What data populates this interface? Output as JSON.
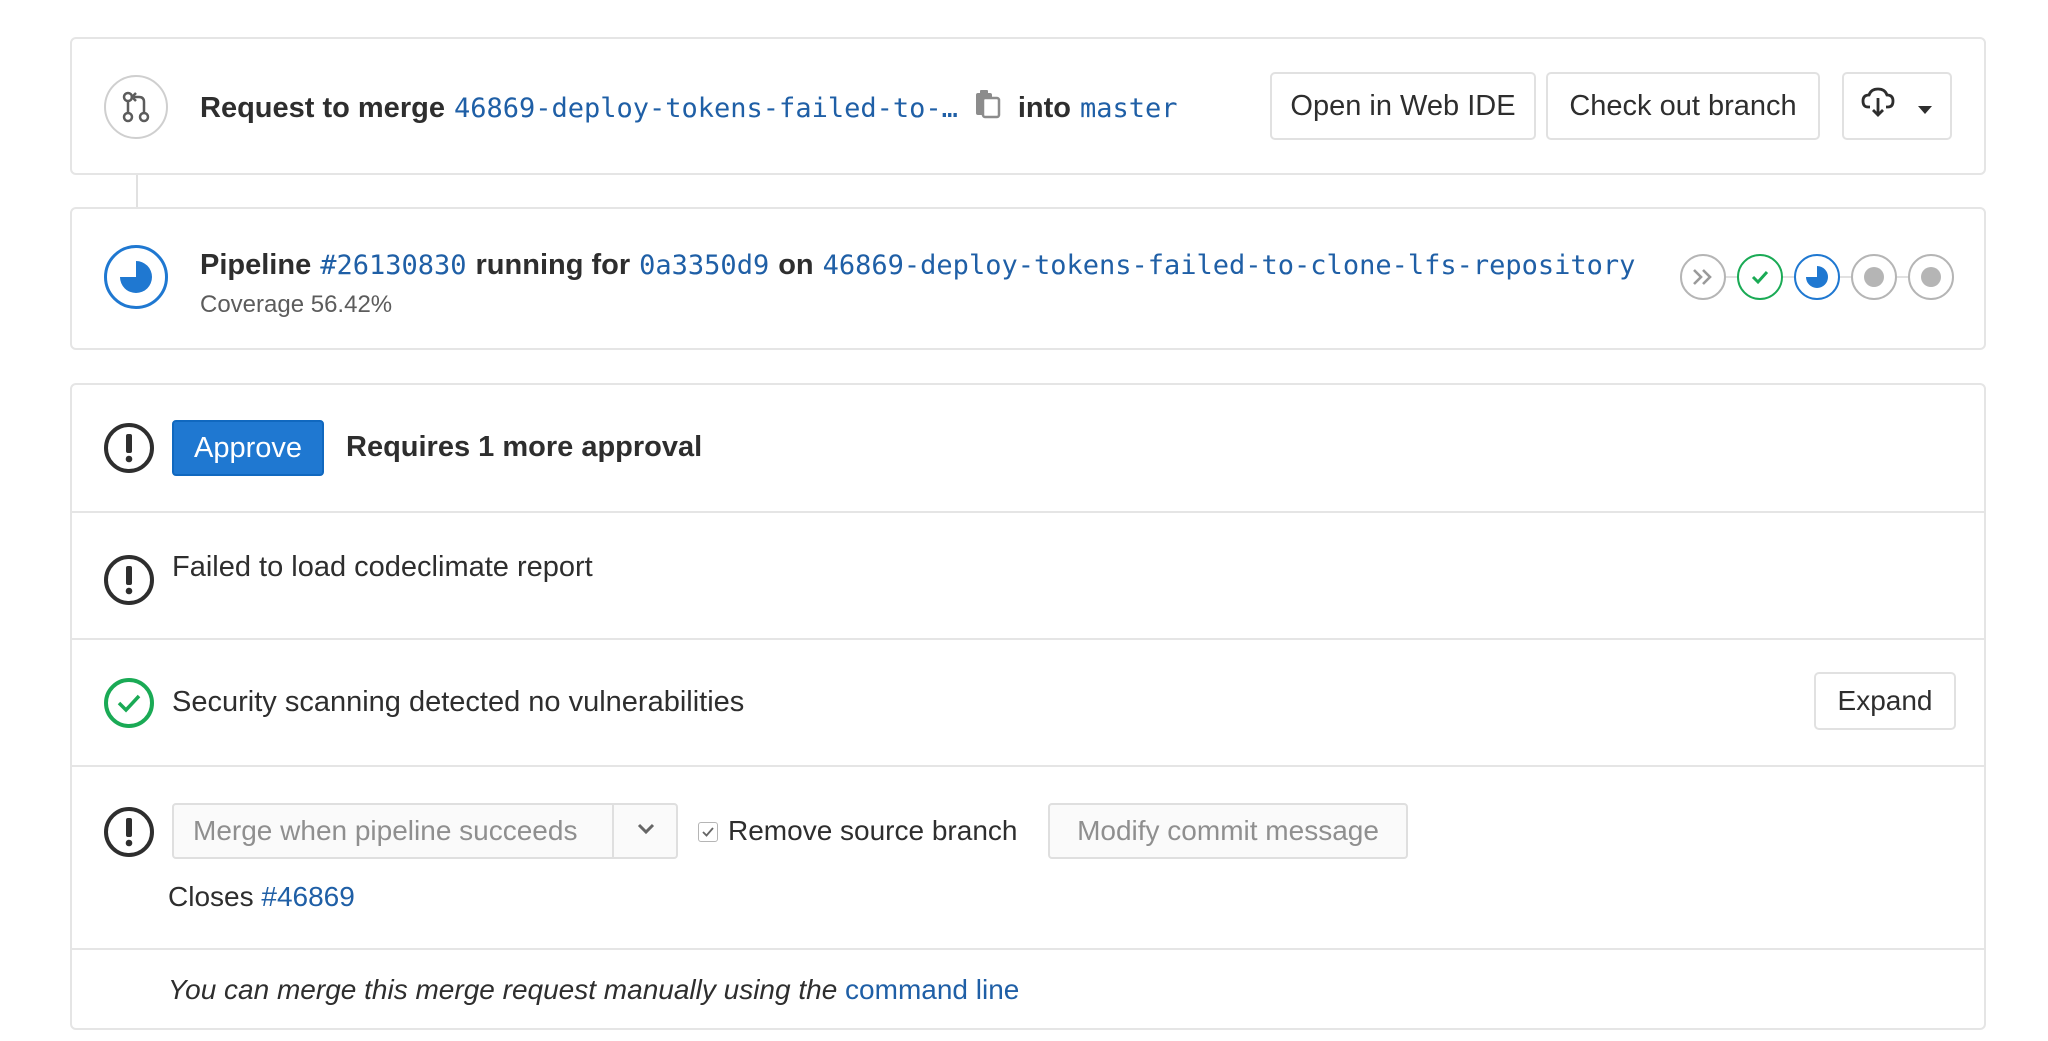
{
  "header": {
    "request_label": "Request to merge",
    "source_branch": "46869-deploy-tokens-failed-to-…",
    "into_label": "into",
    "target_branch": "master",
    "open_web_ide_label": "Open in Web IDE",
    "checkout_branch_label": "Check out branch"
  },
  "pipeline": {
    "label": "Pipeline",
    "id": "#26130830",
    "running_for_label": "running for",
    "commit": "0a3350d9",
    "on_label": "on",
    "branch": "46869-deploy-tokens-failed-to-clone-lfs-repository",
    "coverage": "Coverage 56.42%",
    "stages": [
      "skipped",
      "success",
      "running",
      "created",
      "created"
    ]
  },
  "approval": {
    "approve_label": "Approve",
    "requirement_text": "Requires 1 more approval"
  },
  "codeclimate": {
    "text": "Failed to load codeclimate report"
  },
  "security": {
    "text": "Security scanning detected no vulnerabilities",
    "expand_label": "Expand"
  },
  "merge": {
    "merge_button_label": "Merge when pipeline succeeds",
    "remove_source_label": "Remove source branch",
    "modify_commit_label": "Modify commit message",
    "closes_label": "Closes",
    "closes_issue": "#46869"
  },
  "footer": {
    "manual_text": "You can merge this merge request manually using the",
    "command_line_link": "command line"
  },
  "colors": {
    "link": "#1f5fa6",
    "primary": "#1f78d1",
    "success": "#1aaa55",
    "running": "#1f78d1",
    "border": "#e5e5e5"
  }
}
